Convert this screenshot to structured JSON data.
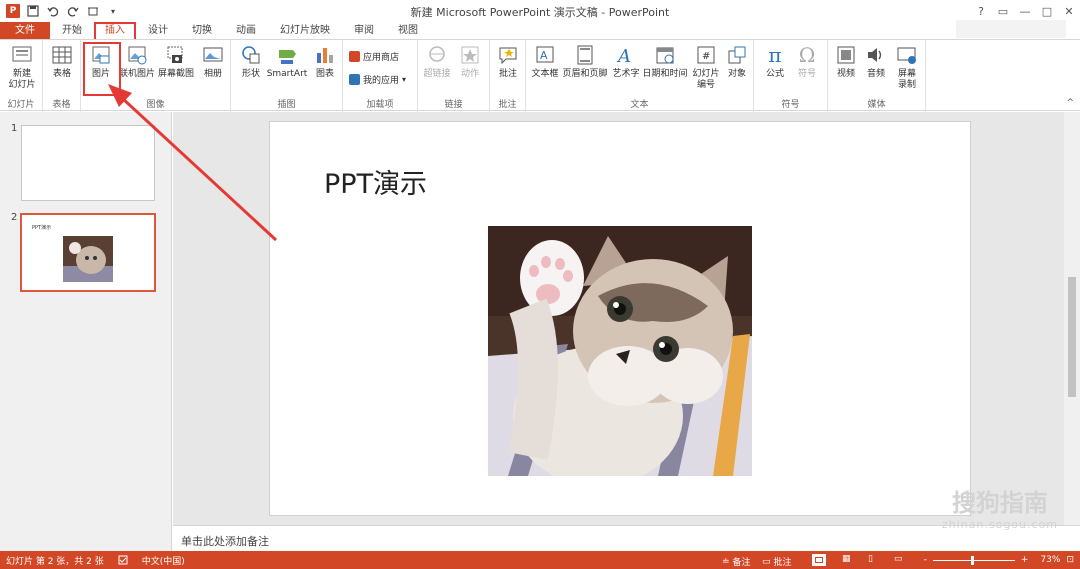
{
  "window": {
    "title": "新建 Microsoft PowerPoint 演示文稿 - PowerPoint"
  },
  "qat": {
    "logo": "P",
    "save": "💾",
    "undo": "↶",
    "redo": "↺",
    "touch": "☞"
  },
  "winctl": {
    "help": "?",
    "restore": "▭",
    "minimize": "—",
    "maximize": "□",
    "close": "✕"
  },
  "tabs": [
    "文件",
    "开始",
    "插入",
    "设计",
    "切换",
    "动画",
    "幻灯片放映",
    "审阅",
    "视图"
  ],
  "ribbon": {
    "groups": {
      "slides": "幻灯片",
      "tables": "表格",
      "images": "图像",
      "illustrations": "插图",
      "addins": "加载项",
      "links": "链接",
      "comments": "批注",
      "text": "文本",
      "symbols": "符号",
      "media": "媒体"
    },
    "buttons": {
      "new_slide": "新建\n幻灯片",
      "table": "表格",
      "picture": "图片",
      "online_picture": "联机图片",
      "screenshot": "屏幕截图",
      "album": "相册",
      "shapes": "形状",
      "smartart": "SmartArt",
      "chart": "图表",
      "store": "应用商店",
      "my_apps": "我的应用",
      "hyperlink": "超链接",
      "action": "动作",
      "comment": "批注",
      "textbox": "文本框",
      "header_footer": "页眉和页脚",
      "wordart": "艺术字",
      "datetime": "日期和时间",
      "slide_number": "幻灯片\n编号",
      "object": "对象",
      "equation": "公式",
      "symbol": "符号",
      "video": "视频",
      "audio": "音频",
      "screen_record": "屏幕\n录制"
    }
  },
  "thumbnails": [
    {
      "number": "1",
      "title": ""
    },
    {
      "number": "2",
      "title": "PPT演示"
    }
  ],
  "slide": {
    "title": "PPT演示"
  },
  "notes": {
    "placeholder": "单击此处添加备注"
  },
  "watermark": {
    "brand": "搜狗指南",
    "url": "zhinan.sogou.com"
  },
  "status": {
    "slide_info": "幻灯片 第 2 张，共 2 张",
    "language": "中文(中国)",
    "notes_btn": "备注",
    "comments_btn": "批注",
    "zoom_minus": "-",
    "zoom_plus": "+",
    "zoom": "73%"
  },
  "colors": {
    "accent": "#d24726",
    "highlight": "#e53935"
  }
}
